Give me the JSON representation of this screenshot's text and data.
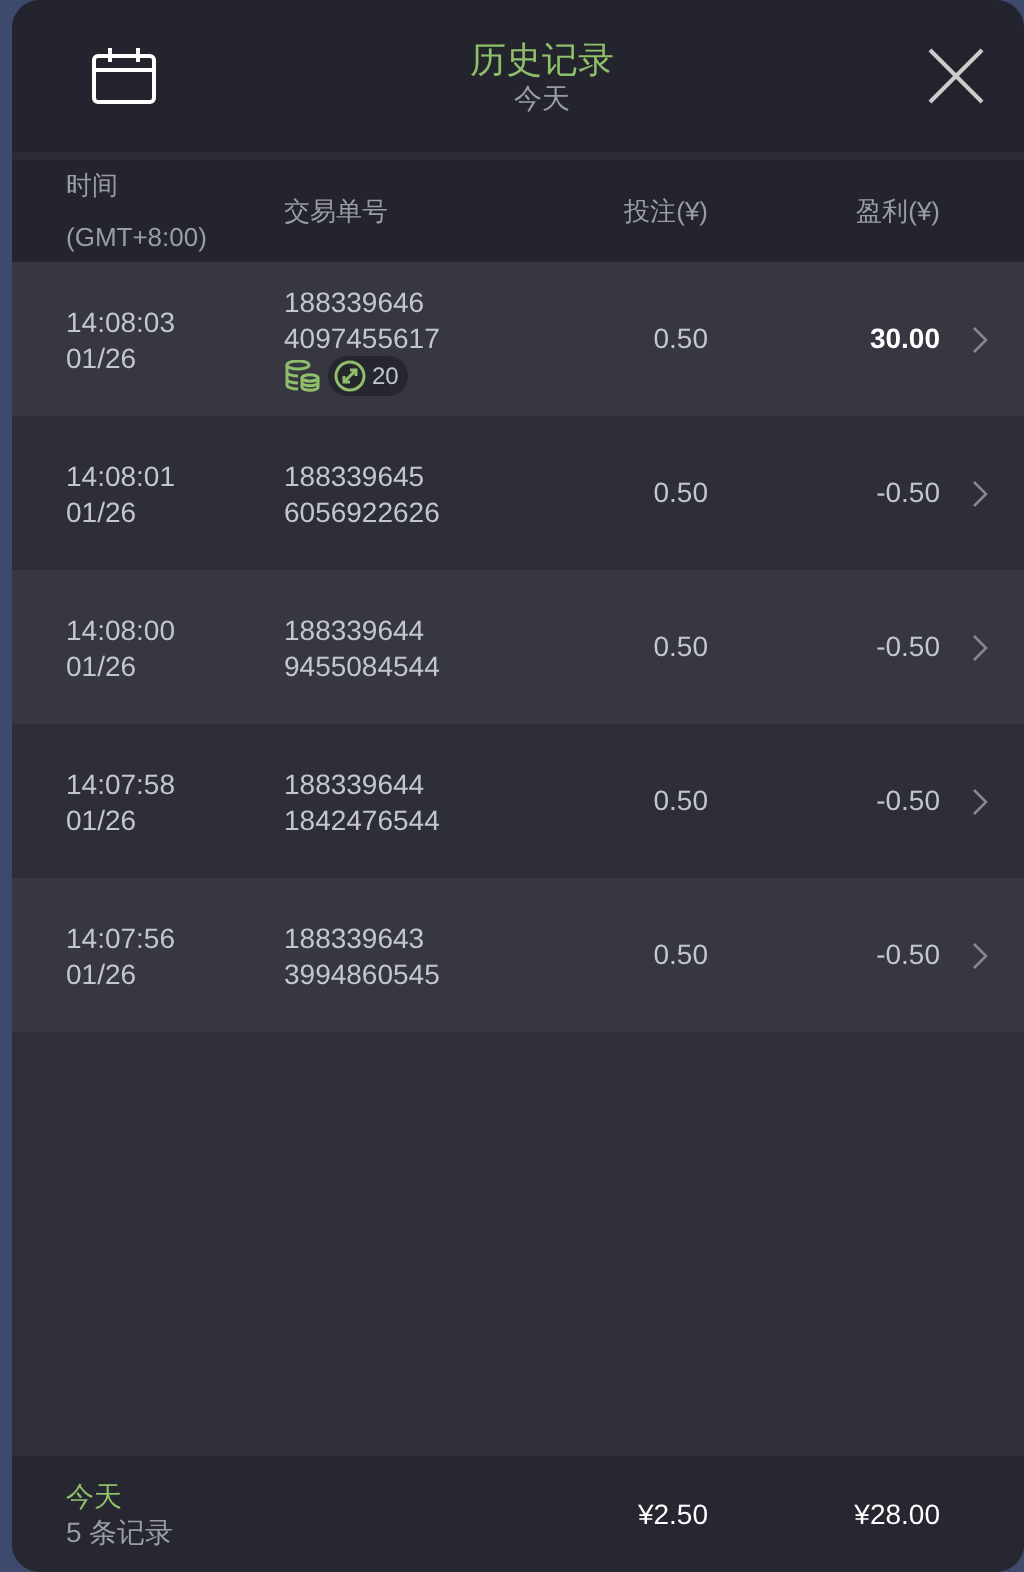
{
  "header": {
    "title": "历史记录",
    "subtitle": "今天"
  },
  "columns": [
    {
      "lines": [
        "时间",
        "(GMT+8:00)"
      ]
    },
    {
      "lines": [
        "交易单号"
      ]
    },
    {
      "lines": [
        "投注(¥)"
      ]
    },
    {
      "lines": [
        "盈利(¥)"
      ]
    }
  ],
  "rows": [
    {
      "time": "14:08:03",
      "date": "01/26",
      "order": [
        "188339646",
        "4097455617"
      ],
      "stake": "0.50",
      "profit": "30.00",
      "won": true,
      "badge": {
        "count": "20"
      }
    },
    {
      "time": "14:08:01",
      "date": "01/26",
      "order": [
        "188339645",
        "6056922626"
      ],
      "stake": "0.50",
      "profit": "-0.50",
      "won": false
    },
    {
      "time": "14:08:00",
      "date": "01/26",
      "order": [
        "188339644",
        "9455084544"
      ],
      "stake": "0.50",
      "profit": "-0.50",
      "won": false
    },
    {
      "time": "14:07:58",
      "date": "01/26",
      "order": [
        "188339644",
        "1842476544"
      ],
      "stake": "0.50",
      "profit": "-0.50",
      "won": false
    },
    {
      "time": "14:07:56",
      "date": "01/26",
      "order": [
        "188339643",
        "3994860545"
      ],
      "stake": "0.50",
      "profit": "-0.50",
      "won": false
    }
  ],
  "footer": {
    "period": "今天",
    "count": "5 条记录",
    "stake_total": "¥2.50",
    "profit_total": "¥28.00"
  }
}
